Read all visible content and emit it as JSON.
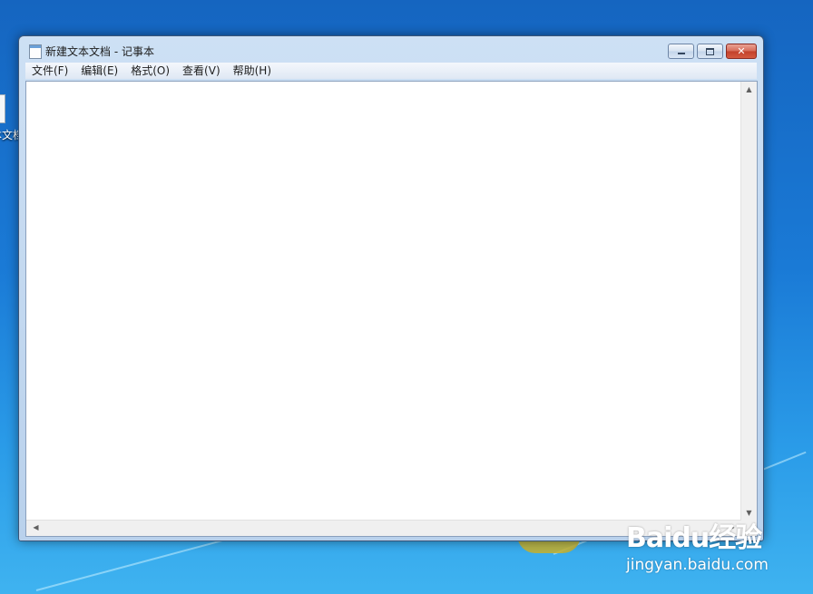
{
  "desktop": {
    "icon_label": "本文档"
  },
  "window": {
    "title": "新建文本文档 - 记事本",
    "controls": {
      "minimize_icon": "minimize-icon",
      "maximize_icon": "maximize-icon",
      "close_icon": "close-icon",
      "close_glyph": "✕"
    }
  },
  "menu": [
    {
      "label": "文件(F)"
    },
    {
      "label": "编辑(E)"
    },
    {
      "label": "格式(O)"
    },
    {
      "label": "查看(V)"
    },
    {
      "label": "帮助(H)"
    }
  ],
  "editor": {
    "content": ""
  },
  "scrollbars": {
    "up": "▲",
    "down": "▼",
    "left": "◀",
    "right": "▶"
  },
  "watermark": {
    "brand": "Baidu经验",
    "url": "jingyan.baidu.com"
  },
  "colors": {
    "desktop": "#1a7ad6",
    "close_button": "#c2402b",
    "window_frame": "#b9d1ec"
  }
}
